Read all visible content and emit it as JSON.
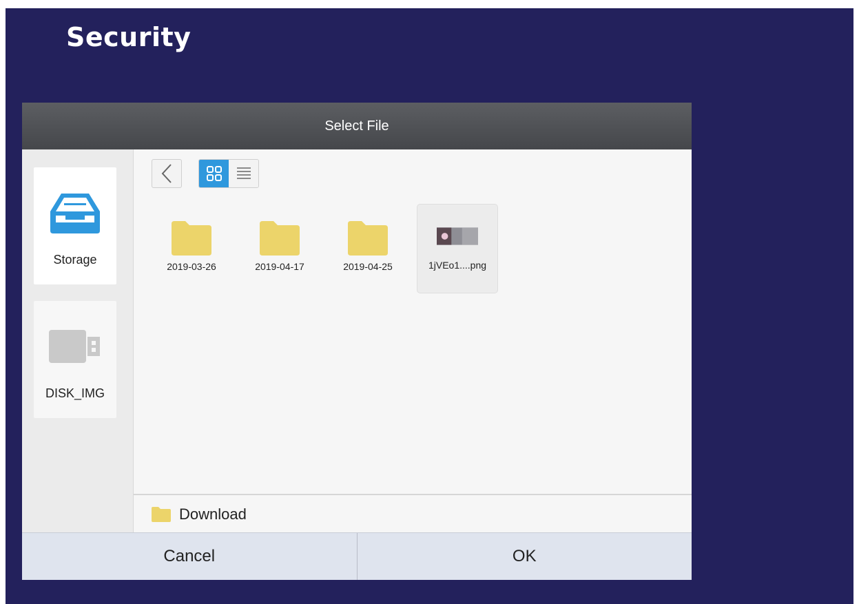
{
  "page": {
    "title": "Security"
  },
  "dialog": {
    "title": "Select File",
    "sources": [
      {
        "label": "Storage",
        "icon": "storage-tray-icon",
        "active": true
      },
      {
        "label": "DISK_IMG",
        "icon": "usb-drive-icon",
        "active": false
      }
    ],
    "toolbar": {
      "back_icon": "chevron-left-icon",
      "view_modes": [
        "grid-view-icon",
        "list-view-icon"
      ],
      "active_view": "grid"
    },
    "files": [
      {
        "name": "2019-03-26",
        "type": "folder"
      },
      {
        "name": "2019-04-17",
        "type": "folder"
      },
      {
        "name": "2019-04-25",
        "type": "folder"
      },
      {
        "name": "1jVEo1....png",
        "type": "image",
        "selected": true
      }
    ],
    "current_path": "Download",
    "buttons": {
      "cancel": "Cancel",
      "ok": "OK"
    }
  },
  "colors": {
    "background": "#23215c",
    "header": "#4f5155",
    "accent": "#2f98dd",
    "folder": "#ecd46a",
    "button_bar": "#dfe4ee"
  }
}
